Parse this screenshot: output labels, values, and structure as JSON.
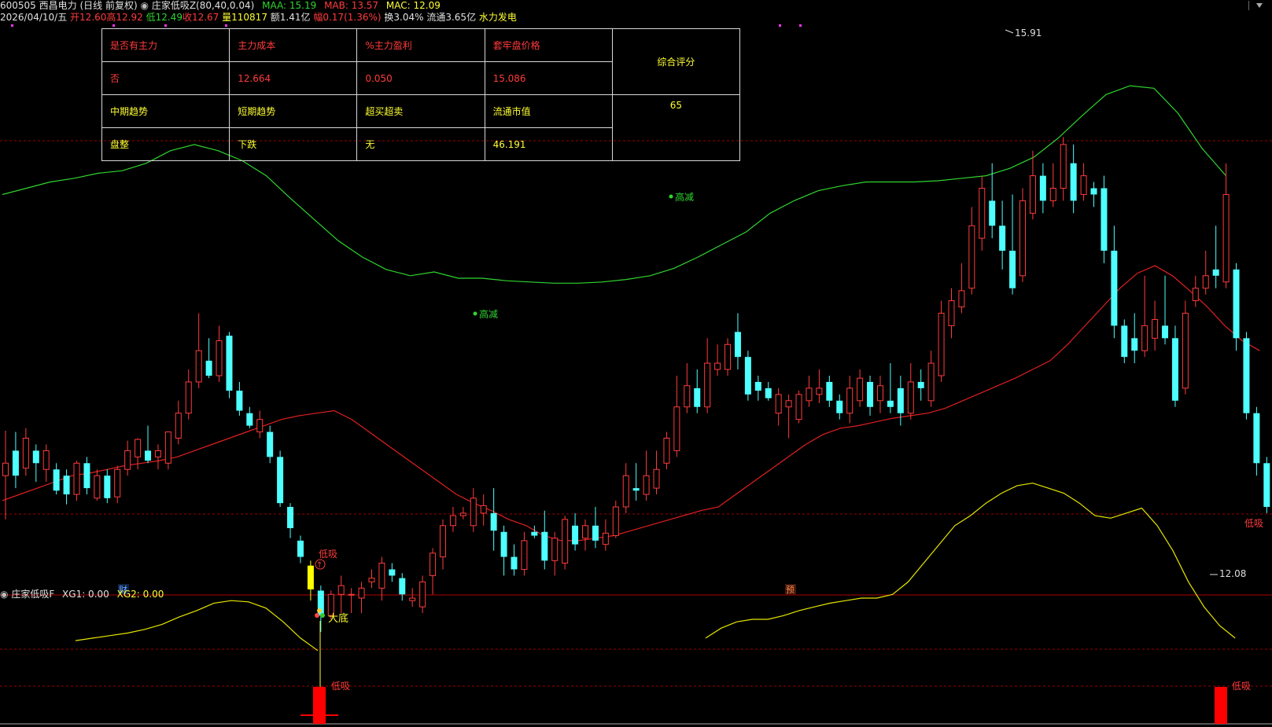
{
  "header": {
    "code": "600505",
    "name": "西昌电力",
    "period": "(日线 前复权)",
    "indicator": "庄家低吸Z(80,40,0.04)",
    "maa_label": "MAA: 15.19",
    "mab_label": "MAB: 13.57",
    "mac_label": "MAC: 12.09",
    "date": "2026/04/10/五",
    "open_label": "开12.60",
    "high_label": "高12.92",
    "low_label": "低12.49",
    "close_label": "收12.67",
    "volume_label": "量110817",
    "amount_label": "额1.41亿",
    "change_label": "幅0.17(1.36%)",
    "turnover_label": "换3.04%",
    "float_label": "流通3.65亿",
    "sector": "水力发电"
  },
  "info_table": {
    "h1": "是否有主力",
    "h2": "主力成本",
    "h3": "%主力盈利",
    "h4": "套牢盘价格",
    "h5": "综合评分",
    "v1": "否",
    "v2": "12.664",
    "v3": "0.050",
    "v4": "15.086",
    "v5": "65",
    "k1": "中期趋势",
    "k2": "短期趋势",
    "k3": "超买超卖",
    "k4": "流通市值",
    "m1": "盘整",
    "m2": "下跌",
    "m3": "无",
    "m4": "46.191"
  },
  "annotations": {
    "high_reduce_1": "高减",
    "high_reduce_2": "高减",
    "low_buy_1": "低吸",
    "low_buy_2": "低吸",
    "max_price": "15.91",
    "min_price": "12.08",
    "cai": "财",
    "yu": "预"
  },
  "sub_panel": {
    "title": "庄家低吸F",
    "xg1": "XG1: 0.00",
    "xg2": "XG2: 0.00",
    "big_bottom": "大底",
    "low_buy_1": "低吸",
    "low_buy_2": "低吸"
  },
  "colors": {
    "up": "#ff3b3b",
    "down": "#4dffff",
    "maa": "#2fd52f",
    "mab": "#e02020",
    "mac": "#e6e600",
    "signal_bar": "#ff0000",
    "magenta": "#ff33ff"
  },
  "chart_data": {
    "type": "candlestick",
    "ylim": [
      11.7,
      16.2
    ],
    "candles": [
      [
        13.2,
        13.3,
        12.85,
        13.56
      ],
      [
        13.4,
        13.2,
        13.1,
        13.55
      ],
      [
        13.26,
        13.5,
        13.2,
        13.58
      ],
      [
        13.4,
        13.3,
        13.15,
        13.45
      ],
      [
        13.25,
        13.4,
        13.15,
        13.45
      ],
      [
        13.25,
        13.08,
        13.05,
        13.3
      ],
      [
        13.2,
        13.05,
        12.97,
        13.25
      ],
      [
        13.05,
        13.3,
        13.0,
        13.32
      ],
      [
        13.3,
        13.1,
        13.05,
        13.35
      ],
      [
        13.02,
        13.2,
        13.0,
        13.25
      ],
      [
        13.2,
        13.02,
        12.98,
        13.25
      ],
      [
        13.03,
        13.25,
        12.98,
        13.28
      ],
      [
        13.25,
        13.4,
        13.2,
        13.48
      ],
      [
        13.35,
        13.49,
        13.25,
        13.5
      ],
      [
        13.4,
        13.32,
        13.3,
        13.6
      ],
      [
        13.35,
        13.4,
        13.25,
        13.45
      ],
      [
        13.3,
        13.55,
        13.25,
        13.55
      ],
      [
        13.5,
        13.7,
        13.45,
        13.8
      ],
      [
        13.7,
        13.95,
        13.65,
        14.05
      ],
      [
        13.95,
        14.2,
        13.9,
        14.5
      ],
      [
        14.12,
        14.0,
        13.98,
        14.3
      ],
      [
        14.0,
        14.28,
        13.95,
        14.4
      ],
      [
        14.32,
        13.88,
        13.82,
        14.35
      ],
      [
        13.88,
        13.72,
        13.68,
        13.95
      ],
      [
        13.7,
        13.6,
        13.58,
        13.75
      ],
      [
        13.55,
        13.65,
        13.5,
        13.72
      ],
      [
        13.55,
        13.35,
        13.3,
        13.6
      ],
      [
        13.35,
        12.98,
        12.95,
        13.4
      ],
      [
        12.95,
        12.78,
        12.7,
        12.98
      ],
      [
        12.68,
        12.55,
        12.5,
        12.72
      ],
      [
        12.48,
        12.29,
        12.2,
        12.52
      ],
      [
        12.28,
        12.08,
        11.95,
        12.32
      ],
      [
        12.08,
        12.25,
        12.05,
        12.28
      ],
      [
        12.25,
        12.32,
        12.1,
        12.4
      ],
      [
        12.25,
        12.25,
        12.1,
        12.3
      ],
      [
        12.22,
        12.3,
        12.1,
        12.35
      ],
      [
        12.35,
        12.38,
        12.3,
        12.45
      ],
      [
        12.3,
        12.5,
        12.2,
        12.55
      ],
      [
        12.45,
        12.4,
        12.35,
        12.5
      ],
      [
        12.38,
        12.25,
        12.2,
        12.42
      ],
      [
        12.2,
        12.22,
        12.15,
        12.3
      ],
      [
        12.15,
        12.35,
        12.1,
        12.4
      ],
      [
        12.4,
        12.58,
        12.25,
        12.62
      ],
      [
        12.55,
        12.8,
        12.45,
        12.85
      ],
      [
        12.8,
        12.88,
        12.75,
        12.95
      ],
      [
        12.88,
        12.9,
        12.85,
        12.95
      ],
      [
        12.8,
        13.02,
        12.75,
        13.1
      ],
      [
        12.9,
        12.96,
        12.8,
        13.05
      ],
      [
        12.9,
        12.76,
        12.6,
        13.1
      ],
      [
        12.75,
        12.55,
        12.4,
        12.8
      ],
      [
        12.55,
        12.45,
        12.4,
        12.65
      ],
      [
        12.45,
        12.68,
        12.4,
        12.75
      ],
      [
        12.75,
        12.72,
        12.7,
        12.8
      ],
      [
        12.75,
        12.52,
        12.45,
        12.92
      ],
      [
        12.52,
        12.7,
        12.4,
        12.75
      ],
      [
        12.5,
        12.85,
        12.45,
        12.88
      ],
      [
        12.8,
        12.65,
        12.6,
        12.9
      ],
      [
        12.7,
        12.8,
        12.6,
        12.85
      ],
      [
        12.8,
        12.68,
        12.62,
        12.95
      ],
      [
        12.65,
        12.74,
        12.6,
        12.85
      ],
      [
        12.72,
        12.95,
        12.7,
        13.0
      ],
      [
        12.95,
        13.2,
        12.9,
        13.3
      ],
      [
        13.1,
        13.08,
        13.0,
        13.3
      ],
      [
        13.05,
        13.2,
        13.0,
        13.4
      ],
      [
        13.1,
        13.25,
        13.05,
        13.4
      ],
      [
        13.3,
        13.5,
        13.25,
        13.55
      ],
      [
        13.4,
        13.75,
        13.35,
        14.0
      ],
      [
        13.75,
        13.92,
        13.7,
        14.1
      ],
      [
        13.9,
        13.75,
        13.7,
        14.05
      ],
      [
        13.75,
        14.1,
        13.7,
        14.3
      ],
      [
        14.05,
        14.1,
        14.0,
        14.25
      ],
      [
        14.05,
        14.25,
        14.0,
        14.3
      ],
      [
        14.35,
        14.15,
        14.05,
        14.5
      ],
      [
        14.15,
        13.85,
        13.8,
        14.2
      ],
      [
        13.95,
        13.88,
        13.8,
        14.0
      ],
      [
        13.9,
        13.82,
        13.8,
        13.95
      ],
      [
        13.7,
        13.85,
        13.6,
        13.9
      ],
      [
        13.75,
        13.8,
        13.5,
        13.85
      ],
      [
        13.65,
        13.85,
        13.62,
        13.88
      ],
      [
        13.8,
        13.9,
        13.75,
        14.0
      ],
      [
        13.85,
        13.9,
        13.78,
        14.05
      ],
      [
        13.95,
        13.8,
        13.75,
        14.0
      ],
      [
        13.8,
        13.7,
        13.65,
        13.85
      ],
      [
        13.7,
        13.9,
        13.62,
        14.0
      ],
      [
        13.8,
        13.98,
        13.75,
        14.05
      ],
      [
        13.95,
        13.75,
        13.68,
        14.0
      ],
      [
        13.8,
        13.92,
        13.7,
        14.0
      ],
      [
        13.8,
        13.75,
        13.7,
        14.1
      ],
      [
        13.9,
        13.7,
        13.6,
        14.0
      ],
      [
        13.7,
        13.95,
        13.65,
        14.1
      ],
      [
        13.95,
        13.9,
        13.8,
        14.05
      ],
      [
        13.8,
        14.1,
        13.75,
        14.2
      ],
      [
        14.0,
        14.5,
        13.95,
        14.6
      ],
      [
        14.4,
        14.6,
        14.3,
        14.7
      ],
      [
        14.55,
        14.68,
        14.5,
        14.9
      ],
      [
        14.7,
        15.2,
        14.65,
        15.35
      ],
      [
        15.1,
        15.5,
        15.0,
        15.6
      ],
      [
        15.4,
        15.2,
        15.1,
        15.7
      ],
      [
        15.2,
        15.0,
        14.85,
        15.4
      ],
      [
        15.0,
        14.7,
        14.65,
        15.45
      ],
      [
        14.8,
        15.4,
        14.75,
        15.5
      ],
      [
        15.3,
        15.6,
        15.25,
        15.8
      ],
      [
        15.6,
        15.4,
        15.3,
        15.7
      ],
      [
        15.4,
        15.5,
        15.35,
        15.7
      ],
      [
        15.5,
        15.85,
        15.4,
        15.91
      ],
      [
        15.7,
        15.4,
        15.3,
        15.85
      ],
      [
        15.45,
        15.6,
        15.4,
        15.7
      ],
      [
        15.5,
        15.45,
        15.35,
        15.55
      ],
      [
        15.5,
        15.0,
        14.9,
        15.6
      ],
      [
        15.0,
        14.4,
        14.3,
        15.2
      ],
      [
        14.4,
        14.15,
        14.1,
        14.45
      ],
      [
        14.3,
        14.2,
        14.1,
        14.5
      ],
      [
        14.2,
        14.4,
        14.15,
        14.8
      ],
      [
        14.3,
        14.45,
        14.2,
        14.6
      ],
      [
        14.4,
        14.3,
        14.25,
        14.8
      ],
      [
        14.3,
        13.8,
        13.75,
        14.4
      ],
      [
        13.9,
        14.5,
        13.85,
        14.6
      ],
      [
        14.6,
        14.7,
        14.55,
        14.8
      ],
      [
        14.7,
        14.8,
        14.65,
        15.0
      ],
      [
        14.85,
        14.8,
        14.7,
        15.2
      ],
      [
        14.75,
        15.45,
        14.7,
        15.7
      ],
      [
        14.85,
        14.3,
        14.2,
        14.9
      ],
      [
        14.3,
        13.7,
        13.65,
        14.35
      ],
      [
        13.7,
        13.3,
        13.2,
        13.75
      ],
      [
        13.3,
        12.95,
        12.9,
        13.35
      ],
      [
        13.0,
        13.3,
        12.9,
        13.4
      ],
      [
        13.2,
        12.41,
        12.38,
        13.25
      ],
      [
        12.5,
        12.38,
        12.08,
        12.45
      ],
      [
        12.4,
        12.55,
        12.3,
        12.58
      ],
      [
        12.42,
        12.6,
        12.35,
        12.62
      ],
      [
        12.48,
        12.57,
        12.4,
        12.75
      ]
    ],
    "series": [
      {
        "name": "MAA",
        "value": 15.19
      },
      {
        "name": "MAB",
        "value": 13.57
      },
      {
        "name": "MAC",
        "value": 12.09
      }
    ],
    "mab_line": [
      13.0,
      13.05,
      13.1,
      13.15,
      13.2,
      13.22,
      13.25,
      13.28,
      13.3,
      13.32,
      13.35,
      13.4,
      13.45,
      13.5,
      13.55,
      13.6,
      13.65,
      13.68,
      13.7,
      13.72,
      13.65,
      13.55,
      13.45,
      13.35,
      13.25,
      13.15,
      13.05,
      12.98,
      12.92,
      12.85,
      12.8,
      12.72,
      12.68,
      12.68,
      12.7,
      12.72,
      12.76,
      12.8,
      12.84,
      12.88,
      12.92,
      12.95,
      13.05,
      13.15,
      13.25,
      13.35,
      13.45,
      13.53,
      13.58,
      13.6,
      13.63,
      13.66,
      13.68,
      13.7,
      13.74,
      13.8,
      13.86,
      13.92,
      13.98,
      14.05,
      14.12,
      14.25,
      14.4,
      14.55,
      14.7,
      14.82,
      14.88,
      14.8,
      14.68,
      14.55,
      14.4,
      14.28,
      14.2
    ],
    "maa_line": [
      15.45,
      15.5,
      15.55,
      15.58,
      15.62,
      15.64,
      15.7,
      15.8,
      15.85,
      15.8,
      15.72,
      15.6,
      15.42,
      15.25,
      15.08,
      14.95,
      14.85,
      14.8,
      14.83,
      14.78,
      14.78,
      14.76,
      14.75,
      14.74,
      14.74,
      14.75,
      14.77,
      14.8,
      14.86,
      14.95,
      15.05,
      15.15,
      15.3,
      15.4,
      15.48,
      15.52,
      15.55,
      15.55,
      15.55,
      15.56,
      15.58,
      15.6,
      15.66,
      15.75,
      15.9,
      16.08,
      16.25,
      16.32,
      16.3,
      16.1,
      15.82,
      15.6
    ],
    "mac_line": [
      11.88,
      11.9,
      11.92,
      11.94,
      11.97,
      12.01,
      12.07,
      12.12,
      12.18,
      12.2,
      12.19,
      12.14,
      12.03,
      11.9,
      11.8
    ],
    "mac_line2": [
      11.9,
      11.98,
      12.03,
      12.05,
      12.05,
      12.08,
      12.12,
      12.15,
      12.18,
      12.2,
      12.22,
      12.22,
      12.25,
      12.35,
      12.5,
      12.65,
      12.8,
      12.88,
      12.98,
      13.06,
      13.12,
      13.14,
      13.1,
      13.06,
      12.98,
      12.88,
      12.86,
      12.9,
      12.94,
      12.8,
      12.6,
      12.35,
      12.15,
      12.0,
      11.9
    ]
  }
}
